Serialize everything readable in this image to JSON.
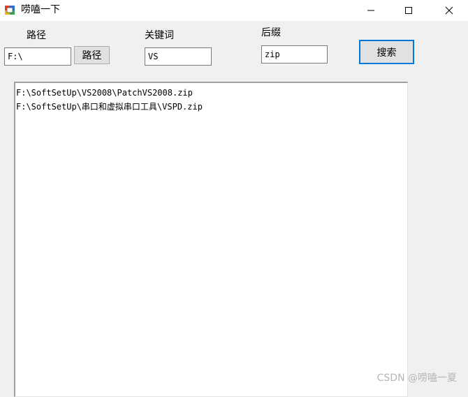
{
  "window": {
    "title": "唠嗑一下",
    "controls": [
      "minimize",
      "maximize",
      "close"
    ]
  },
  "form": {
    "path_label": "路径",
    "path_value": "F:\\",
    "path_button": "路径",
    "keyword_label": "关键词",
    "keyword_value": "VS",
    "suffix_label": "后缀",
    "suffix_value": "zip",
    "search_button": "搜索"
  },
  "results": [
    "F:\\SoftSetUp\\VS2008\\PatchVS2008.zip",
    "F:\\SoftSetUp\\串口和虚拟串口工具\\VSPD.zip"
  ],
  "watermark": "CSDN @唠嗑一夏"
}
